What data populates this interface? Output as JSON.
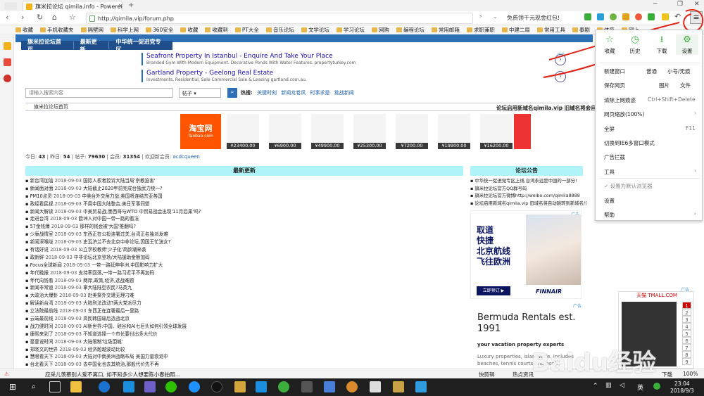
{
  "browser": {
    "tab_title": "旗米拉论坛 qimila.info - Poweredby",
    "url": "http://qimila.vip/forum.php",
    "promo": "免费领千元现金红包!",
    "bookmarks": [
      "收藏",
      "手机收藏夹",
      "隔壁网",
      "科学上网",
      "360安全",
      "收藏",
      "收藏到",
      "PT大全",
      "音乐论坛",
      "文学论坛",
      "学习论坛",
      "网购",
      "编程论坛",
      "常用邮箱",
      "求职兼职",
      "中建二局",
      "常用工具",
      "泰剧",
      "体育",
      "网上"
    ]
  },
  "site": {
    "nav": [
      "旗米拉论坛首页",
      "最新更新",
      "中华统一促进党专区"
    ],
    "ads": [
      {
        "title": "Seafront Property In Istanbul - Enquire And Take Your Place",
        "desc": "Branded Gym With Modern Equipment. Decorative Ponds With Water Features. propertyturkey.com",
        "badge": "广告"
      },
      {
        "title": "Gartland Property - Geelong Real Estate",
        "desc": "Investments, Residential, Sale Commercial Sale & Leasing gartland.com.au",
        "badge": "广告"
      }
    ],
    "search": {
      "placeholder": "请输入搜索内容",
      "select": "帖子",
      "hot_label": "热搜:",
      "hot": [
        "关键时刻",
        "新闻龙卷风",
        "时事求是",
        "挑战新闻"
      ]
    },
    "breadcrumb": "旗米拉论坛首页",
    "notice": "论坛启用新域名qimila.vip 旧域名将会自动跳转",
    "taobao": {
      "name": "淘宝网",
      "url": "Taobao.com"
    },
    "prices": [
      "¥23400.00",
      "¥6900.00",
      "¥49900.00",
      "¥25300.00",
      "¥7200.00",
      "¥19900.00",
      "¥16200.00"
    ],
    "stats": {
      "today_label": "今日:",
      "today": "43",
      "yesterday_label": "昨日:",
      "yesterday": "54",
      "posts_label": "帖子:",
      "posts": "79630",
      "members_label": "会员:",
      "members": "31354",
      "welcome": "欢迎新会员:",
      "newest": "acdcqueen"
    },
    "newest_head": "最新更新",
    "board_head": "论坛公告",
    "news": [
      {
        "t": "新台湾加油",
        "d": "2018-09-03",
        "x": "国际人权者控诉大陆当局'宗教迫害'"
      },
      {
        "t": "新闻面对面",
        "d": "2018-09-03",
        "x": "大陆截止2020年前完成台独武力统一?"
      },
      {
        "t": "PM10点灵",
        "d": "2018-09-03",
        "x": "中美台外交角力战,美国将连结东亚各国"
      },
      {
        "t": "政经看民视",
        "d": "2018-09-03",
        "x": "不用中国大陆整合,美日军事同盟"
      },
      {
        "t": "新闻大解读",
        "d": "2018-09-03",
        "x": "中美贸易战,墨西哥与WTO 中贸易战会出现'11月后果'吗?"
      },
      {
        "t": "走进台湾",
        "d": "2018-09-03",
        "x": "欧洲人对中国一带一路的看法"
      },
      {
        "t": "57金钱爆",
        "d": "2018-09-03",
        "x": "那样的钱会被'大国'推翻吗?"
      },
      {
        "t": "少康战情室",
        "d": "2018-09-03",
        "x": "东西正在公投连署过关,台湾正名独派发难"
      },
      {
        "t": "新闻深喉咙",
        "d": "2018-09-03",
        "x": "史瓦济兰不去北京中非论坛,因国王忙送女?"
      },
      {
        "t": "有话好说",
        "d": "2018-09-03",
        "x": "公立学校教师'少子化'高龄潮来袭"
      },
      {
        "t": "政新鲜",
        "d": "2018-09-03",
        "x": "中非论坛北京登场/大陆援助金额加码"
      },
      {
        "t": "Focus全球新闻",
        "d": "2018-09-03",
        "x": "一带一路延伸非洲,中国影响力扩大"
      },
      {
        "t": "年代晚报",
        "d": "2018-09-03",
        "x": "支持率回落,一带一路习近平不再加码"
      },
      {
        "t": "年代向钱看",
        "d": "2018-09-03",
        "x": "两岸,政策,经济,选战难题"
      },
      {
        "t": "新闻非常道",
        "d": "2018-09-03",
        "x": "拿大陆陆空农民?马英九"
      },
      {
        "t": "大政治大爆卦",
        "d": "2018-09-03",
        "x": "赴美祭外交遭无理刁难"
      },
      {
        "t": "解读新台湾",
        "d": "2018-09-03",
        "x": "大陆刑法改动?两大党派尽力"
      },
      {
        "t": "立法院最前线",
        "d": "2018-09-03",
        "x": "东西正在连署最后一里路"
      },
      {
        "t": "云端最前线",
        "d": "2018-09-03",
        "x": "高民韩国瑜后选战北京"
      },
      {
        "t": "战力健时间",
        "d": "2018-09-03",
        "x": "AI新世界:中国、硅谷和AI七巨头如何引领全球发展"
      },
      {
        "t": "康熙来到了",
        "d": "2018-09-03",
        "x": "不知道选择一个市长要付出多大代价"
      },
      {
        "t": "蔓蔓说时间",
        "d": "2018-09-03",
        "x": "大陆限制'垃圾围城'"
      },
      {
        "t": "郑晓文的世界",
        "d": "2018-09-03",
        "x": "经济超越波动比较"
      },
      {
        "t": "慧眼看天下",
        "d": "2018-09-03",
        "x": "大陆对中南美洲战略布局 美国力量衰退中"
      },
      {
        "t": "台北看天下",
        "d": "2018-09-03",
        "x": "去中国化也去其统治,那般代价先不再"
      }
    ],
    "board": [
      "中华统一促进党专区上线,台湾永远是中国的一部分!",
      "旗米拉论坛官方QQ群号码",
      "旗米拉论坛官方微博http://weibo.com/qimila8888",
      "论坛启用新域名qimila.vip 旧域名将自动跳转到新域名/访问不变"
    ],
    "finnair": {
      "badge": "广告",
      "l1": "取道",
      "l2": "快捷",
      "l3": "北京航线",
      "l4": "飞往欧洲",
      "cta": "立即预订 ▶",
      "logo": "FINNAIR"
    },
    "bermuda": {
      "badge": "广告",
      "title": "Bermuda Rentals est. 1991",
      "sub": "your vacation property experts",
      "desc": "Luxury properties, islandwide. Includes beaches, tennis courts and pools."
    },
    "tmall": {
      "head": "天猫 TMALL.COM",
      "badge": "广告",
      "nums": [
        "1",
        "2",
        "3",
        "4",
        "5",
        "6",
        "7",
        "8",
        "9"
      ]
    }
  },
  "menu": {
    "top": [
      {
        "label": "收藏",
        "icon": "☆"
      },
      {
        "label": "历史",
        "icon": "◷"
      },
      {
        "label": "下载",
        "icon": "⭳"
      },
      {
        "label": "设置",
        "icon": "⚙"
      }
    ],
    "new_window": "新建窗口",
    "normal": "普通",
    "small": "小号/无痕",
    "save": "保存网页",
    "image": "图片",
    "text": "文件",
    "clear": "清除上网痕迹",
    "clear_key": "Ctrl+Shift+Delete",
    "zoom": "网页缩放(100%)",
    "full": "全屏",
    "full_key": "F11",
    "ie": "切换到IE6多窗口模式",
    "adblock": "广告拦截",
    "tools": "工具",
    "default": "设置为默认浏览器",
    "settings": "设置",
    "help": "帮助"
  },
  "status": {
    "ticker": "应采儿羡慕别人爱不离口, 如不知多少人想要陈小春拍照...",
    "icons": [
      "快剪辑",
      "热点资讯",
      "下载",
      "100%"
    ]
  },
  "taskbar": {
    "time": "23:04",
    "date": "2018/9/3",
    "lang": "英"
  },
  "watermark": "Baidu经验"
}
